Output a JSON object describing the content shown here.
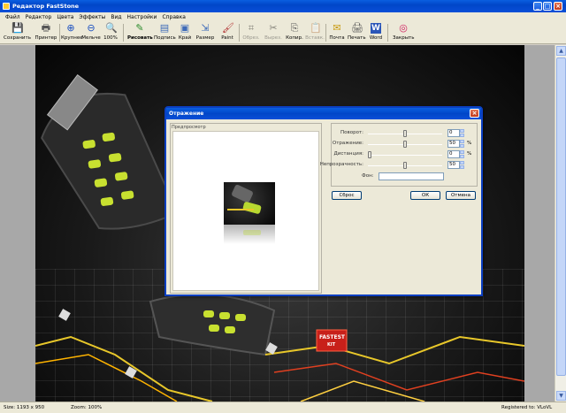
{
  "window": {
    "title": "Редактор FastStone",
    "controls": [
      "_",
      "□",
      "×"
    ]
  },
  "menu": [
    "Файл",
    "Редактор",
    "Цвета",
    "Эффекты",
    "Вид",
    "Настройки",
    "Справка"
  ],
  "toolbar": {
    "items": [
      {
        "label": "Сохранить",
        "icon": "save-icon",
        "glyph": "💾",
        "enabled": true
      },
      {
        "label": "Принтер",
        "icon": "printer-icon",
        "glyph": "🖶",
        "enabled": true
      },
      {
        "label": "Крупнее",
        "icon": "zoom-in-icon",
        "glyph": "⊕",
        "enabled": true
      },
      {
        "label": "Мельче",
        "icon": "zoom-out-icon",
        "glyph": "⊖",
        "enabled": true
      },
      {
        "label": "100%",
        "icon": "zoom-100-icon",
        "glyph": "🔍",
        "enabled": true
      },
      {
        "label": "Рисовать",
        "icon": "draw-icon",
        "glyph": "✎",
        "enabled": true
      },
      {
        "label": "Подпись",
        "icon": "caption-icon",
        "glyph": "▤",
        "enabled": true
      },
      {
        "label": "Край",
        "icon": "edge-icon",
        "glyph": "▣",
        "enabled": true
      },
      {
        "label": "Размер",
        "icon": "resize-icon",
        "glyph": "⇲",
        "enabled": true
      },
      {
        "label": "Paint",
        "icon": "paint-icon",
        "glyph": "🖌",
        "enabled": true
      },
      {
        "label": "Обрез.",
        "icon": "crop-icon",
        "glyph": "⌗",
        "enabled": false
      },
      {
        "label": "Вырез.",
        "icon": "cut-icon",
        "glyph": "✂",
        "enabled": false
      },
      {
        "label": "Копир.",
        "icon": "copy-icon",
        "glyph": "⎘",
        "enabled": true
      },
      {
        "label": "Вставк.",
        "icon": "paste-icon",
        "glyph": "📋",
        "enabled": false
      },
      {
        "label": "Почта",
        "icon": "mail-icon",
        "glyph": "✉",
        "enabled": true
      },
      {
        "label": "Печать",
        "icon": "print-icon",
        "glyph": "🖨",
        "enabled": true
      },
      {
        "label": "Word",
        "icon": "word-icon",
        "glyph": "W",
        "enabled": true
      },
      {
        "label": "Закрыть",
        "icon": "close-circle-icon",
        "glyph": "◎",
        "enabled": true
      }
    ]
  },
  "canvas_badges": {
    "fastest": "FASTEST",
    "kit": "KIT"
  },
  "status": {
    "size": "Size: 1193 x 950",
    "zoom": "Zoom: 100%",
    "registered": "Registered to: VLoVL"
  },
  "dialog": {
    "title": "Отражение",
    "preview_label": "Предпросмотр",
    "controls": [
      {
        "label": "Поворот:",
        "value": "0",
        "unit": "",
        "slider_fraction": 0.5
      },
      {
        "label": "Отражение:",
        "value": "50",
        "unit": "%",
        "slider_fraction": 0.5
      },
      {
        "label": "Дистанция:",
        "value": "0",
        "unit": "%",
        "slider_fraction": 0.0
      },
      {
        "label": "Непрозрачность:",
        "value": "50",
        "unit": "",
        "slider_fraction": 0.5
      }
    ],
    "background_label": "Фон:",
    "reset_button": "Сброс",
    "ok_button": "ОК",
    "cancel_button": "Отмена"
  }
}
